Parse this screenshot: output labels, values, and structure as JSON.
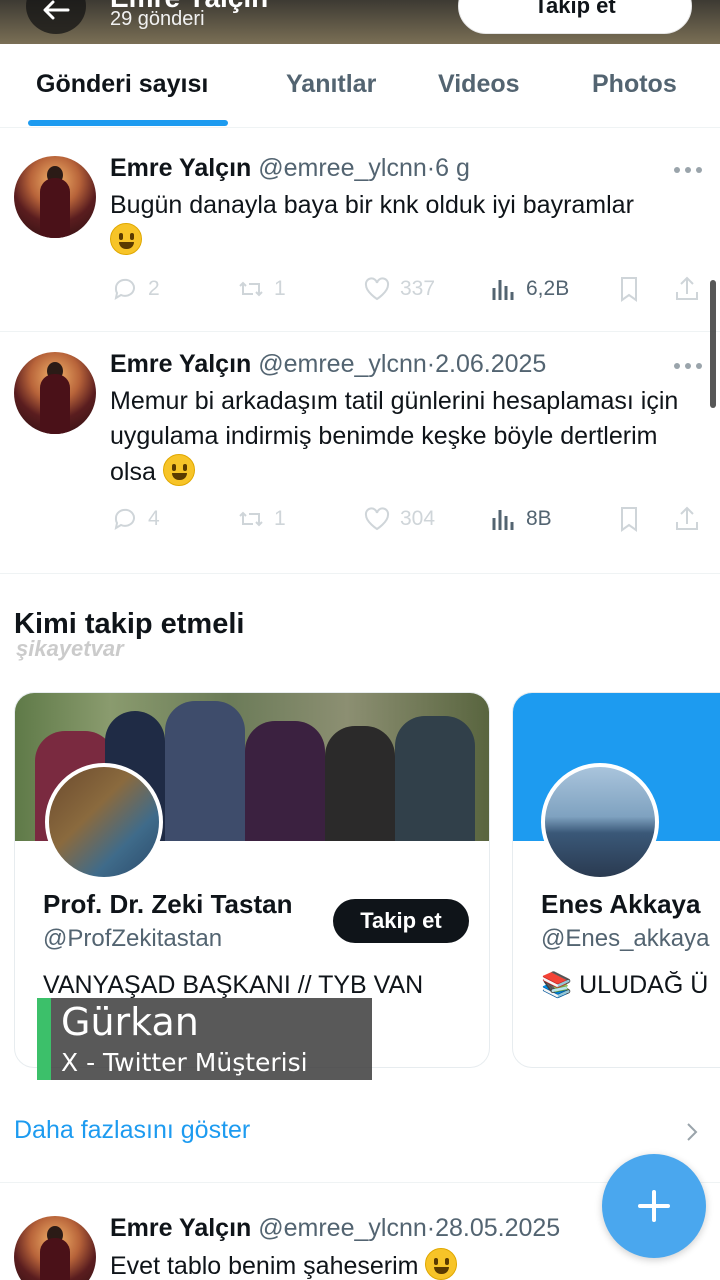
{
  "header": {
    "profile_name": "Emre Yalçın",
    "post_count": "29 gönderi",
    "follow_label": "Takip et"
  },
  "tabs": [
    {
      "label": "Gönderi sayısı",
      "active": true
    },
    {
      "label": "Yanıtlar",
      "active": false
    },
    {
      "label": "Videos",
      "active": false
    },
    {
      "label": "Photos",
      "active": false
    }
  ],
  "tweets": [
    {
      "name": "Emre Yalçın",
      "handle": "@emree_ylcnn",
      "sep": "·",
      "time": "6 g",
      "text": "Bugün danayla baya bir knk olduk iyi bayramlar",
      "emoji": "grinning-face",
      "replies": "2",
      "retweets": "1",
      "likes": "337",
      "views": "6,2B"
    },
    {
      "name": "Emre Yalçın",
      "handle": "@emree_ylcnn",
      "sep": "·",
      "time": "2.06.2025",
      "text": "Memur bi arkadaşım tatil günlerini hesaplaması için uygulama indirmiş benimde keşke böyle dertlerim olsa",
      "emoji": "grinning-face",
      "replies": "4",
      "retweets": "1",
      "likes": "304",
      "views": "8B"
    },
    {
      "name": "Emre Yalçın",
      "handle": "@emree_ylcnn",
      "sep": "·",
      "time": "28.05.2025",
      "text": "Evet tablo benim şaheserim",
      "emoji": "grinning-face-with-sweat"
    }
  ],
  "who_to_follow": {
    "title": "Kimi takip etmeli",
    "watermark": "şikayetvar",
    "cards": [
      {
        "name": "Prof. Dr. Zeki Tastan",
        "handle": "@ProfZekitastan",
        "bio": "VANYAŞAD BAŞKANI // TYB VAN",
        "follow_label": "Takip et"
      },
      {
        "name": "Enes Akkaya",
        "handle": "@Enes_akkaya",
        "bio": "📚 ULUDAĞ Ü"
      }
    ],
    "show_more": "Daha fazlasını göster"
  },
  "caller_overlay": {
    "name": "Gürkan",
    "subtitle": "X - Twitter Müşterisi",
    "accent": "#3cc06a"
  },
  "colors": {
    "accent": "#1d9bf0",
    "fab": "#4aa7ee",
    "text_primary": "#0f1419",
    "text_secondary": "#536471"
  }
}
